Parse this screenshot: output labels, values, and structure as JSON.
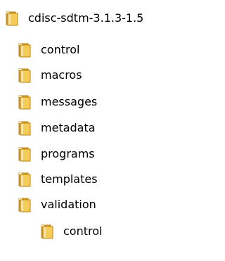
{
  "tree": {
    "root": {
      "label": "cdisc-sdtm-3.1.3-1.5",
      "icon": "folder-icon"
    },
    "children": [
      {
        "label": "control",
        "icon": "folder-icon"
      },
      {
        "label": "macros",
        "icon": "folder-icon"
      },
      {
        "label": "messages",
        "icon": "folder-icon"
      },
      {
        "label": "metadata",
        "icon": "folder-icon"
      },
      {
        "label": "programs",
        "icon": "folder-icon"
      },
      {
        "label": "templates",
        "icon": "folder-icon"
      },
      {
        "label": "validation",
        "icon": "folder-icon"
      }
    ],
    "grandchildren": [
      {
        "label": "control",
        "icon": "folder-icon"
      }
    ]
  },
  "colors": {
    "folder_front": "#f4cc5a",
    "folder_back": "#d9a227",
    "folder_edge": "#b88416",
    "text": "#000000",
    "background": "#ffffff"
  }
}
